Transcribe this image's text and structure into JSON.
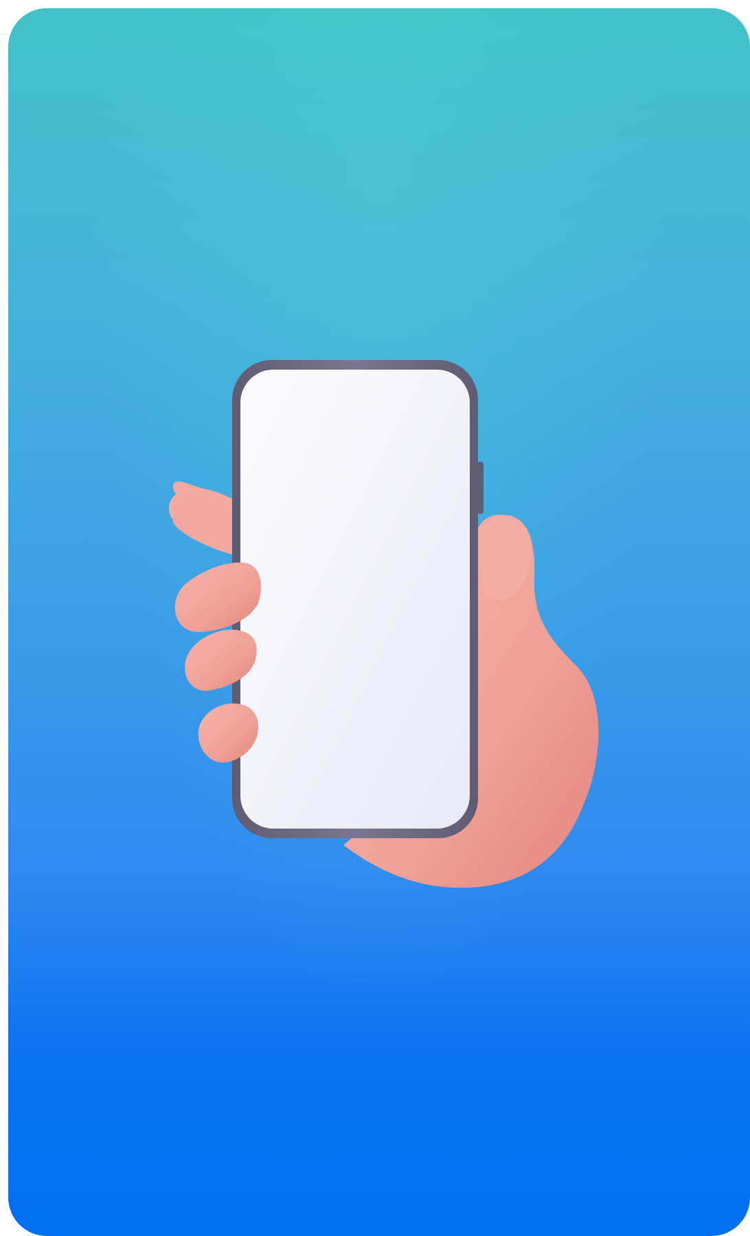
{
  "illustration": {
    "subject": "hand-holding-phone",
    "colors": {
      "background_top": "#42c2c8",
      "background_bottom": "#0070f0",
      "skin": "#f4a9a0",
      "skin_shadow": "#e4877f",
      "phone_frame": "#6e6a80",
      "phone_screen": "#f1f2f8"
    }
  }
}
